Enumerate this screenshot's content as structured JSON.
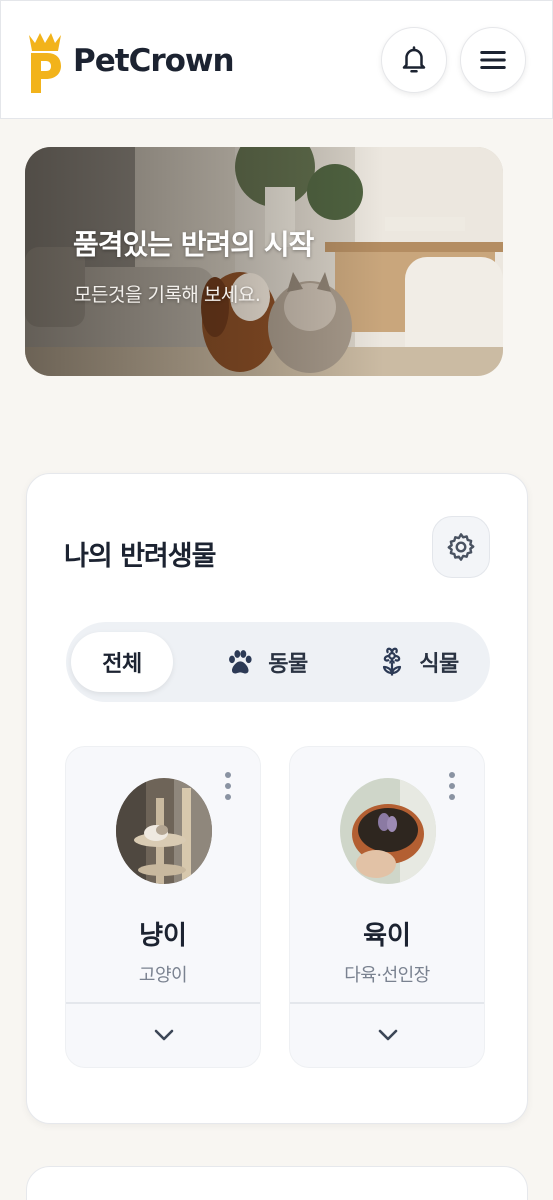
{
  "header": {
    "brand": "PetCrown",
    "notification_icon": "bell-icon",
    "menu_icon": "menu-icon"
  },
  "hero": {
    "title": "품격있는 반려의 시작",
    "subtitle": "모든것을 기록해 보세요."
  },
  "pets": {
    "title": "나의 반려생물",
    "settings_icon": "gear-icon",
    "tabs": [
      {
        "label": "전체",
        "active": true,
        "icon": ""
      },
      {
        "label": "동물",
        "active": false,
        "icon": "paw-icon"
      },
      {
        "label": "식물",
        "active": false,
        "icon": "flower-icon"
      }
    ],
    "items": [
      {
        "name": "냥이",
        "kind": "고양이"
      },
      {
        "name": "육이",
        "kind": "다육·선인장"
      }
    ]
  },
  "colors": {
    "background": "#f8f6f2",
    "text": "#1c2331",
    "muted_text": "#7a8290",
    "brand_gold": "#f2b31b"
  }
}
